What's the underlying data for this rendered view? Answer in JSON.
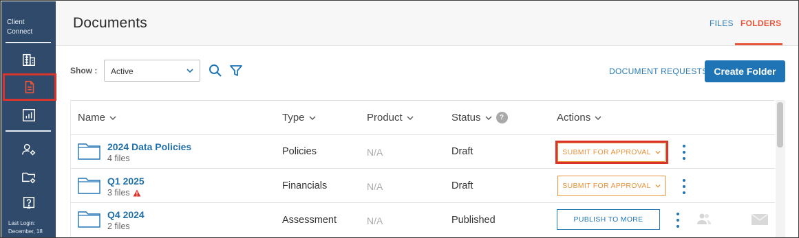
{
  "sidebar": {
    "brand_line1": "Client",
    "brand_line2": "Connect",
    "items": [
      {
        "icon": "building-icon"
      },
      {
        "icon": "document-icon",
        "active": true
      },
      {
        "icon": "report-chart-icon"
      },
      {
        "icon": "user-settings-icon"
      },
      {
        "icon": "folder-settings-icon"
      },
      {
        "icon": "help-icon"
      }
    ],
    "last_login_line1": "Last Login:",
    "last_login_line2": "December, 18"
  },
  "header": {
    "title": "Documents",
    "tabs": [
      {
        "label": "FILES",
        "active": false
      },
      {
        "label": "FOLDERS",
        "active": true
      }
    ]
  },
  "toolbar": {
    "show_label": "Show :",
    "show_value": "Active",
    "search_icon": "search-icon",
    "filter_icon": "filter-icon",
    "document_requests": "DOCUMENT REQUESTS",
    "create_folder": "Create Folder"
  },
  "table": {
    "columns": [
      "Name",
      "Type",
      "Product",
      "Status",
      "Actions"
    ],
    "rows": [
      {
        "name": "2024 Data Policies",
        "files": "4 files",
        "warning": false,
        "type": "Policies",
        "product": "N/A",
        "status": "Draft",
        "action": "SUBMIT FOR APPROVAL"
      },
      {
        "name": "Q1 2025",
        "files": "3 files",
        "warning": true,
        "type": "Financials",
        "product": "N/A",
        "status": "Draft",
        "action": "SUBMIT FOR APPROVAL"
      },
      {
        "name": "Q4 2024",
        "files": "2 files",
        "warning": false,
        "type": "Assessment",
        "product": "N/A",
        "status": "Published",
        "action": "PUBLISH TO MORE"
      }
    ]
  },
  "colors": {
    "sidebar": "#2f4a6b",
    "accent_blue": "#1f74b6",
    "accent_orange": "#e8913a",
    "tab_active": "#e8553a",
    "highlight_red": "#d9342b"
  }
}
